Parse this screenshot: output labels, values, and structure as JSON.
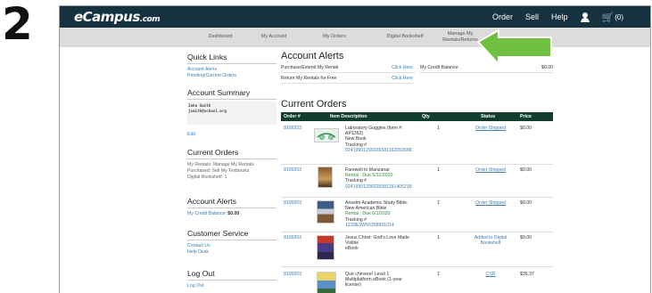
{
  "step_number": "2",
  "brand": {
    "logo": "eCampus",
    "logo_suffix": ".com"
  },
  "top_nav": {
    "order": "Order",
    "sell": "Sell",
    "help": "Help",
    "cart_count": "(0)"
  },
  "sub_nav": [
    "Dashboard",
    "My Account",
    "My Orders",
    "Digital Bookshelf",
    "Manage My Rentals/Returns"
  ],
  "sidebar": {
    "quick_links": {
      "title": "Quick Links",
      "links": [
        "Account Alerts",
        "Pending/Current Orders"
      ]
    },
    "account_summary": {
      "title": "Account Summary",
      "name": "John Smith",
      "email": "jsmith@school.org",
      "edit": "Edit"
    },
    "current_orders": {
      "title": "Current Orders",
      "lines": [
        "My Rentals: Manage My Rentals",
        "Purchased: Sell My Textbooks",
        "Digital Bookshelf: 1"
      ]
    },
    "account_alerts": {
      "title": "Account Alerts",
      "credit_label": "My Credit Balance: ",
      "credit_value": "$0.00"
    },
    "customer_service": {
      "title": "Customer Service",
      "links": [
        "Contact Us",
        "Help Desk"
      ]
    },
    "log_out": {
      "title": "Log Out",
      "link": "Log Out"
    }
  },
  "account_alerts": {
    "title": "Account Alerts",
    "rows": [
      {
        "label": "Purchase/Extend My Rental",
        "action": "Click Here"
      },
      {
        "label": "Return My Rentals for Free",
        "action": "Click Here"
      }
    ],
    "credit_label": "My Credit Balance:",
    "credit_value": "$0.00"
  },
  "current_orders": {
    "title": "Current Orders",
    "columns": [
      "Order #",
      "Item Description",
      "Qty",
      "Status",
      "Price"
    ],
    "rows": [
      {
        "order": "8199203",
        "lines": [
          "Laboratory Goggles (Item #:",
          "AP1362)",
          "New Book",
          "Tracking #"
        ],
        "tracking": "9241990129602658116205958​8",
        "qty": "1",
        "status": "Order Shipped",
        "price": "$0.00"
      },
      {
        "order": "8199203",
        "lines": [
          "Farewell to Manzanar"
        ],
        "rental_due": "Rental : Due 5/31/2020",
        "lines2": [
          "Tracking #"
        ],
        "tracking": "9241990129602658116140521​8",
        "qty": "1",
        "status": "Order Shipped",
        "price": "$0.00"
      },
      {
        "order": "8199203",
        "lines": [
          "Anselm Academic Study Bible:",
          "New American Bible"
        ],
        "rental_due": "Rental : Due 6/1/2020",
        "lines2": [
          "Tracking #"
        ],
        "tracking": "1Z28E3W50358951014",
        "qty": "1",
        "status": "Order Shipped",
        "price": "$0.00"
      },
      {
        "order": "8199203",
        "lines": [
          "Jesus Christ: God's Love Made",
          "Visible",
          "eBook"
        ],
        "qty": "1",
        "status": "Added to Digital Bookshelf",
        "price": "$0.00"
      },
      {
        "order": "8199203",
        "lines": [
          "Que chevere! Level 1",
          "Multiplatform eBook (1-year",
          "license)"
        ],
        "qty": "1",
        "status": "CSR",
        "price": "$35.37"
      }
    ]
  },
  "colors": {
    "topbar": "#17323f",
    "subnav": "#dcdcdc",
    "table_header": "#0f3f2c",
    "link": "#3c7fb8",
    "arrow": "#6fc13f",
    "rental_due": "#2b8a3e"
  }
}
